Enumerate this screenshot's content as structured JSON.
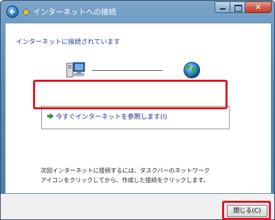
{
  "window": {
    "title": "インターネットへの接続",
    "close_glyph": "✕"
  },
  "main": {
    "heading": "インターネットに接続されています",
    "browse_option": "今すぐインターネットを参照します(I)",
    "instruction_line1": "次回インターネットに接続するには、タスクバーのネットワーク",
    "instruction_line2": "アイコンをクリックしてから、作成した接続をクリックします。"
  },
  "footer": {
    "close_label": "閉じる(C)"
  },
  "icons": {
    "back": "back-arrow-icon",
    "wizard": "network-wizard-icon",
    "computer": "computer-icon",
    "globe": "globe-icon",
    "option_arrow": "green-arrow-icon"
  },
  "colors": {
    "highlight": "#e0141f",
    "heading_text": "#1f3d99",
    "option_text": "#1a2a88",
    "title_bar": "#5c89b3"
  }
}
